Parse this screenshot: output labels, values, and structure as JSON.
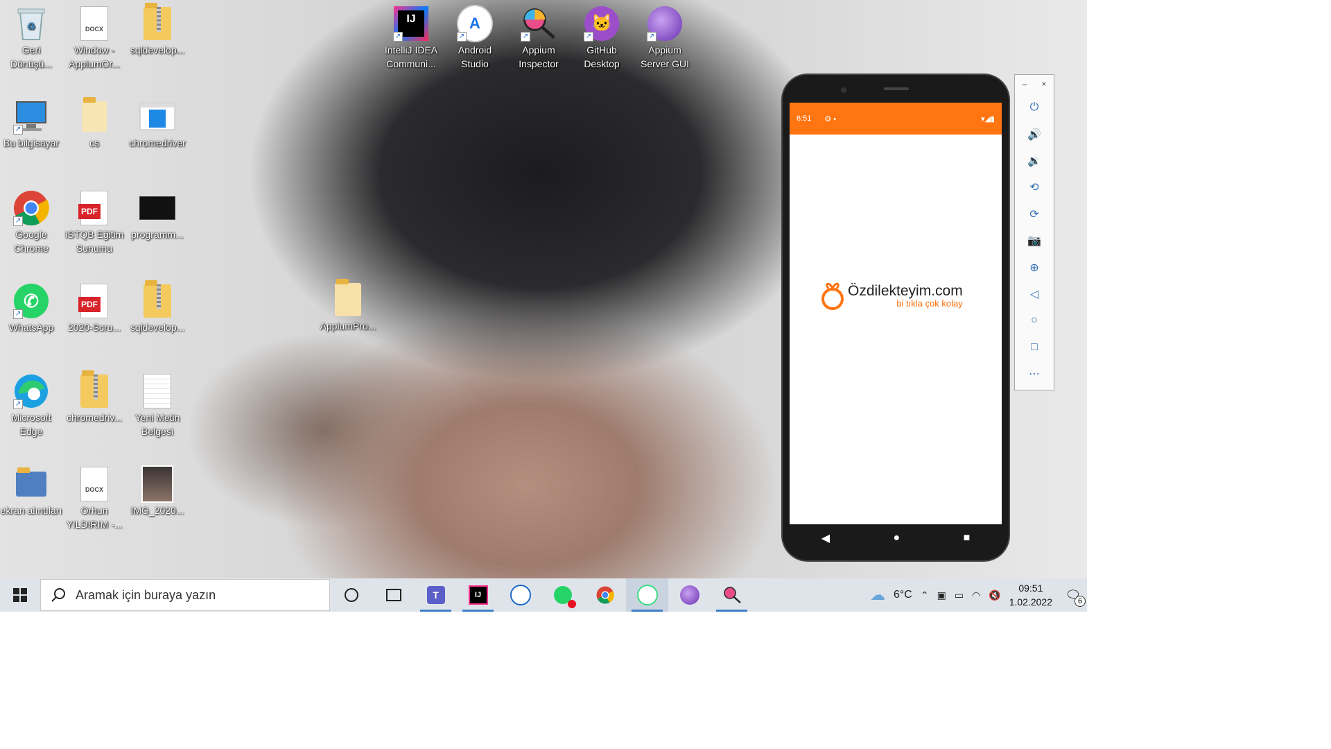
{
  "desktop": {
    "icons": [
      {
        "label": "Geri Dönüşü..."
      },
      {
        "label": "Window -AppiumOr..."
      },
      {
        "label": "sqldevelop..."
      },
      {
        "label": "Bu bilgisayar"
      },
      {
        "label": "cs"
      },
      {
        "label": "chromedriver"
      },
      {
        "label": "Google Chrome"
      },
      {
        "label": "ISTQB Eğitim Sunumu"
      },
      {
        "label": "programm..."
      },
      {
        "label": "WhatsApp"
      },
      {
        "label": "2020-Scru..."
      },
      {
        "label": "sqldevelop..."
      },
      {
        "label": "Microsoft Edge"
      },
      {
        "label": "chromedriv..."
      },
      {
        "label": "Yeni Metin Belgesi"
      },
      {
        "label": "ekran alıntıları"
      },
      {
        "label": "Orhun YILDIRIM -..."
      },
      {
        "label": "IMG_2020..."
      },
      {
        "label": "AppiumPro..."
      },
      {
        "label": "IntelliJ IDEA Communi..."
      },
      {
        "label": "Android Studio"
      },
      {
        "label": "Appium Inspector"
      },
      {
        "label": "GitHub Desktop"
      },
      {
        "label": "Appium Server GUI"
      }
    ],
    "docx_tag": "DOCX",
    "pdf_tag": "PDF",
    "ij_tag": "IJ"
  },
  "phone": {
    "status_time": "6:51",
    "brand_name": "Özdilekteyim.com",
    "brand_tagline": "bi tıkla çok kolay",
    "accent_color": "#ff7512"
  },
  "emulator_panel": {
    "minimize": "–",
    "close": "×",
    "buttons": [
      "power-icon",
      "volume-up-icon",
      "volume-down-icon",
      "rotate-left-icon",
      "rotate-right-icon",
      "camera-icon",
      "zoom-icon",
      "back-icon",
      "home-icon",
      "overview-icon",
      "more-icon"
    ]
  },
  "taskbar": {
    "search_placeholder": "Aramak için buraya yazın",
    "weather_temp": "6°C",
    "time": "09:51",
    "date": "1.02.2022",
    "notification_count": "6",
    "apps": [
      "cortana-icon",
      "task-view-icon",
      "teams-icon",
      "intellij-icon",
      "notepad-icon",
      "whatsapp-icon",
      "chrome-icon",
      "android-studio-icon",
      "appium-icon",
      "appium-inspector-icon"
    ]
  }
}
